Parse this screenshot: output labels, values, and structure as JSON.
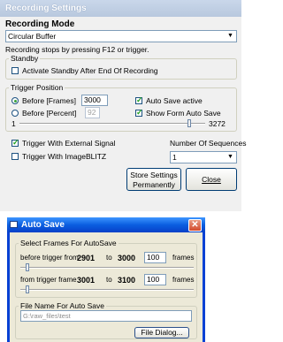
{
  "recording_settings": {
    "title": "Recording Settings",
    "recording_mode_label": "Recording Mode",
    "recording_mode_value": "Circular Buffer",
    "info_text": "Recording stops by pressing F12 or trigger.",
    "standby": {
      "group_label": "Standby",
      "activate_label": "Activate Standby After End Of Recording",
      "activate_checked": false
    },
    "trigger_position": {
      "group_label": "Trigger Position",
      "before_frames_label": "Before [Frames]",
      "before_frames_value": "3000",
      "before_frames_selected": true,
      "before_percent_label": "Before [Percent]",
      "before_percent_value": "92",
      "slider_min": "1",
      "slider_max": "3272",
      "slider_level_percent": 92,
      "auto_save_label": "Auto Save active",
      "auto_save_checked": true,
      "show_form_label": "Show Form Auto Save",
      "show_form_checked": true
    },
    "trigger_external_label": "Trigger With External Signal",
    "trigger_external_checked": true,
    "trigger_imageblitz_label": "Trigger With ImageBLITZ",
    "trigger_imageblitz_checked": false,
    "sequences_label": "Number Of Sequences",
    "sequences_value": "1",
    "store_button_line1": "Store Settings",
    "store_button_line2": "Permanently",
    "close_button_label": "Close"
  },
  "auto_save": {
    "title": "Auto Save",
    "select_group_label": "Select Frames For AutoSave",
    "before_trigger_label": "before trigger from",
    "before_from": "2901",
    "to_label_1": "to",
    "before_to": "3000",
    "before_count": "100",
    "frames_label_1": "frames",
    "before_slider_level_percent": 3,
    "from_trigger_label": "from trigger frame",
    "after_from": "3001",
    "to_label_2": "to",
    "after_to": "3100",
    "after_count": "100",
    "frames_label_2": "frames",
    "after_slider_level_percent": 3,
    "file_group_label": "File Name For Auto Save",
    "file_name": "G:\\raw_files\\test",
    "file_dialog_label": "File Dialog..."
  },
  "colors": {
    "title_active": "#0a5ee0",
    "title_inactive": "#b8c8de",
    "window_bg": "#ece9d8",
    "check_green": "#21a121"
  }
}
